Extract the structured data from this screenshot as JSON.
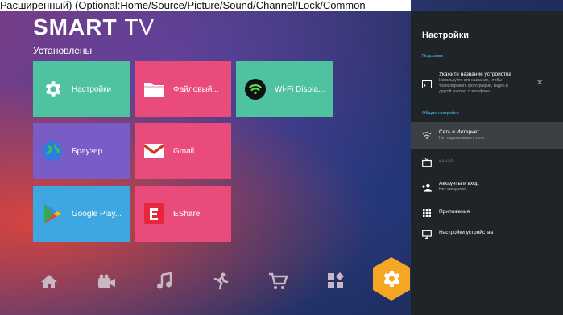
{
  "topline": "Расширенный) (Optional:Home/Source/Picture/Sound/Channel/Lock/Common",
  "brand": {
    "bold": "SMART",
    "light": "TV"
  },
  "installed_label": "Установлены",
  "tiles": [
    {
      "label": "Настройки",
      "icon": "gear-icon",
      "color": "#4fc3a1"
    },
    {
      "label": "Файловый...",
      "icon": "folder-icon",
      "color": "#e94c7a"
    },
    {
      "label": "Wi-Fi Displa...",
      "icon": "wifi-icon",
      "color": "#4fc3a1"
    },
    {
      "label": "Браузер",
      "icon": "globe-icon",
      "color": "#7a5cc6"
    },
    {
      "label": "Gmail",
      "icon": "gmail-icon",
      "color": "#e94c7a"
    },
    {
      "label": "Google Play...",
      "icon": "play-store-icon",
      "color": "#3ea7e0"
    },
    {
      "label": "EShare",
      "icon": "eshare-icon",
      "color": "#e94c7a"
    }
  ],
  "bottom_nav": [
    {
      "icon": "home-icon"
    },
    {
      "icon": "video-icon"
    },
    {
      "icon": "music-icon"
    },
    {
      "icon": "sports-icon"
    },
    {
      "icon": "cart-icon"
    },
    {
      "icon": "apps-icon"
    },
    {
      "icon": "settings-gear-icon",
      "active": true,
      "color": "#f5a623"
    }
  ],
  "settings_panel": {
    "title": "Настройки",
    "hints_header": "Подсказки",
    "hint": {
      "title": "Укажите название устройства",
      "desc1": "Используйте это название, чтобы",
      "desc2": "транслировать фотографии, видео и",
      "desc3": "другой контент с телефона."
    },
    "general_header": "Общие настройки",
    "items": [
      {
        "label": "Сеть и Интернет",
        "sub": "Нет подключения к сети",
        "icon": "wifi-icon"
      },
      {
        "label": "канал",
        "sub": "",
        "icon": "tv-icon"
      },
      {
        "label": "Аккаунты и вход",
        "sub": "Нет аккаунтов",
        "icon": "add-account-icon"
      },
      {
        "label": "Приложения",
        "sub": "",
        "icon": "apps-grid-icon"
      },
      {
        "label": "Настройки устройства",
        "sub": "",
        "icon": "monitor-icon"
      }
    ]
  }
}
